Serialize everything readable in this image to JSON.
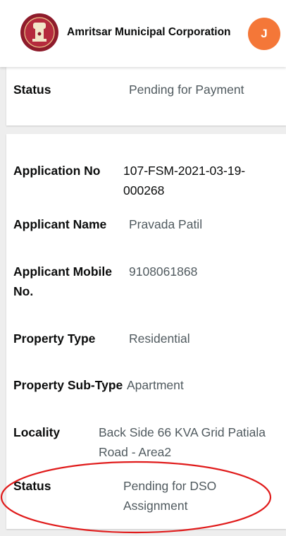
{
  "header": {
    "org_name": "Amritsar Municipal Corporation",
    "avatar_initial": "J",
    "avatar_color": "#f47738"
  },
  "summary": {
    "status_label": "Status",
    "status_value": "Pending for Payment"
  },
  "details": [
    {
      "label": "Application No",
      "value": "107-FSM-2021-03-19-000268"
    },
    {
      "label": "Applicant Name",
      "value": "Pravada Patil"
    },
    {
      "label": "Applicant Mobile No.",
      "value": "9108061868"
    },
    {
      "label": "Property Type",
      "value": "Residential"
    },
    {
      "label": "Property Sub-Type",
      "value": "Apartment"
    },
    {
      "label": "Locality",
      "value": "Back Side 66 KVA Grid Patiala Road - Area2"
    },
    {
      "label": "Status",
      "value": "Pending for DSO Assignment"
    }
  ],
  "highlight_color": "#e01b1b"
}
